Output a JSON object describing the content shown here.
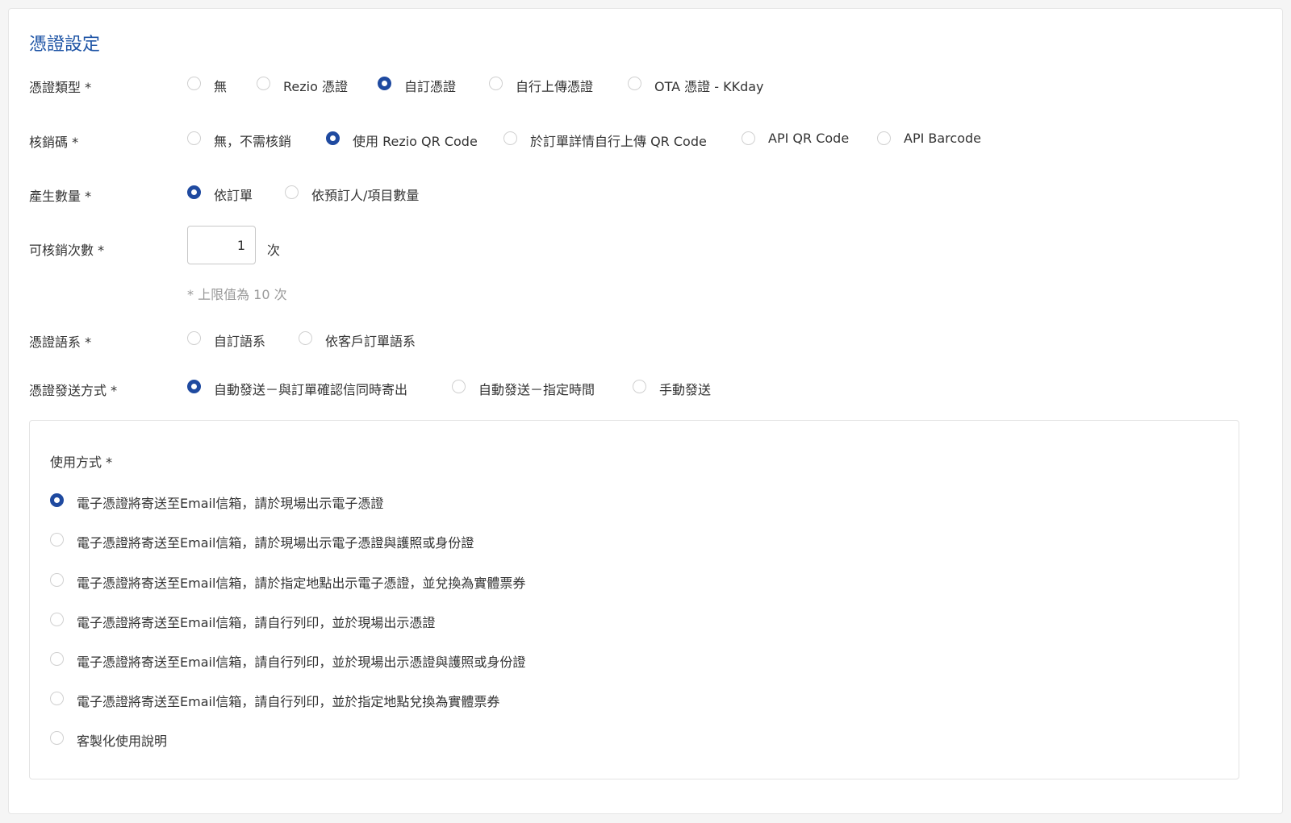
{
  "section": {
    "title": "憑證設定"
  },
  "voucher_type": {
    "label": "憑證類型 *",
    "options": [
      "無",
      "Rezio 憑證",
      "自訂憑證",
      "自行上傳憑證",
      "OTA 憑證 - KKday"
    ],
    "selected": "自訂憑證"
  },
  "redeem_code": {
    "label": "核銷碼 *",
    "options": [
      "無，不需核銷",
      "使用 Rezio QR Code",
      "於訂單詳情自行上傳 QR Code",
      "API QR Code",
      "API Barcode"
    ],
    "selected": "使用 Rezio QR Code"
  },
  "quantity": {
    "label": "產生數量 *",
    "options": [
      "依訂單",
      "依預訂人/項目數量"
    ],
    "selected": "依訂單"
  },
  "redeem_times": {
    "label": "可核銷次數 *",
    "value": "1",
    "unit": "次",
    "hint": "* 上限值為 10 次"
  },
  "language": {
    "label": "憑證語系 *",
    "options": [
      "自訂語系",
      "依客戶訂單語系"
    ],
    "selected": null
  },
  "delivery": {
    "label": "憑證發送方式 *",
    "options": [
      "自動發送－與訂單確認信同時寄出",
      "自動發送－指定時間",
      "手動發送"
    ],
    "selected": "自動發送－與訂單確認信同時寄出"
  },
  "usage": {
    "label": "使用方式 *",
    "options": [
      "電子憑證將寄送至Email信箱，請於現場出示電子憑證",
      "電子憑證將寄送至Email信箱，請於現場出示電子憑證與護照或身份證",
      "電子憑證將寄送至Email信箱，請於指定地點出示電子憑證，並兌換為實體票券",
      "電子憑證將寄送至Email信箱，請自行列印，並於現場出示憑證",
      "電子憑證將寄送至Email信箱，請自行列印，並於現場出示憑證與護照或身份證",
      "電子憑證將寄送至Email信箱，請自行列印，並於指定地點兌換為實體票券",
      "客製化使用說明"
    ],
    "selected": "電子憑證將寄送至Email信箱，請於現場出示電子憑證"
  },
  "colors": {
    "accent": "#1f4aa0",
    "title": "#1f55a6",
    "hint": "#999999",
    "border": "#e3e3e3"
  }
}
